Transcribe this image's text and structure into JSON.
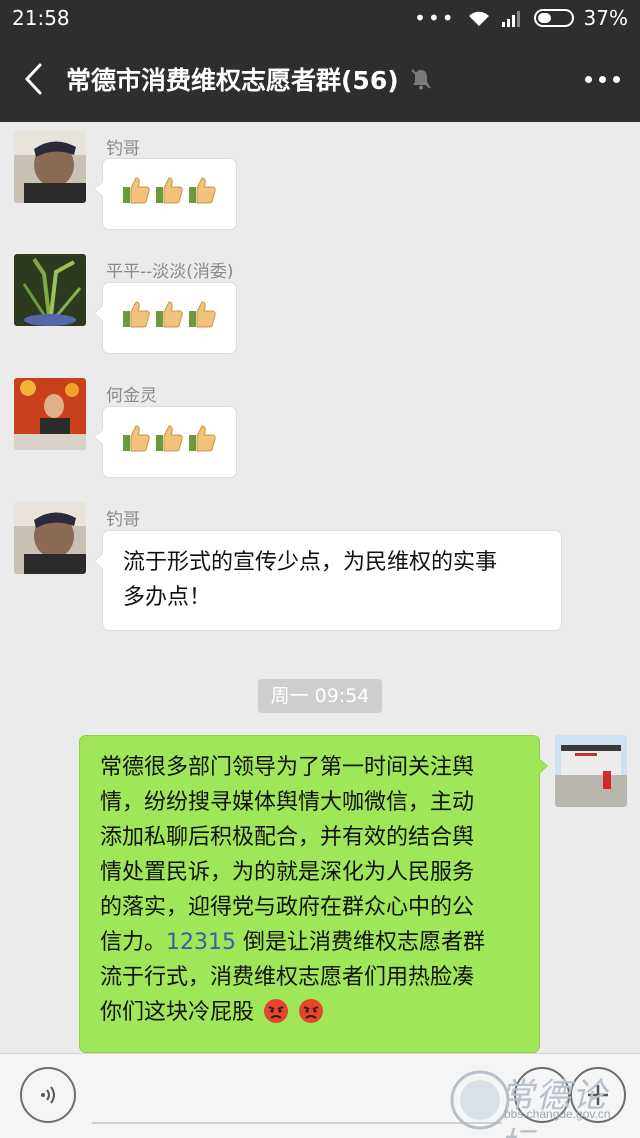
{
  "status_bar": {
    "time": "21:58",
    "dots": "•••",
    "battery_percent": "37%",
    "battery_level": 0.37
  },
  "header": {
    "title": "常德市消费维权志愿者群(56)",
    "muted": true
  },
  "messages": [
    {
      "sender": "钓哥",
      "content": "thumbs",
      "thumb_count": 3
    },
    {
      "sender": "平平--淡淡(消委)",
      "content": "thumbs",
      "thumb_count": 3
    },
    {
      "sender": "何金灵",
      "content": "thumbs",
      "thumb_count": 3
    },
    {
      "sender": "钓哥",
      "lines": [
        "流于形式的宣传少点，为民维权的实事",
        "多办点！"
      ]
    }
  ],
  "timestamp": "周一 09:54",
  "outgoing": {
    "lines": [
      "常德很多部门领导为了第一时间关注舆",
      "情，纷纷搜寻媒体舆情大咖微信，主动",
      "添加私聊后积极配合，并有效的结合舆",
      "情处置民诉，为的就是深化为人民服务",
      "的落实，迎得党与政府在群众心中的公",
      "信力。",
      "倒是让消费维权志愿者群",
      "流于行式，消费维权志愿者们用热脸凑",
      "你们这块冷屁股"
    ],
    "phone_number": "12315"
  },
  "watermark": {
    "text_cn": "常德论坛",
    "url": "bbs.changde.gov.cn"
  },
  "icons": [
    "back-arrow-icon",
    "mute-bell-icon",
    "more-icon",
    "voice-icon",
    "emoji-icon",
    "plus-icon",
    "thumbs-up-icon",
    "angry-face-icon"
  ],
  "colors": {
    "header_bg": "#2e2e2e",
    "chat_bg": "#ebebeb",
    "outgoing_bubble": "#9fe658",
    "link": "#3a5fa6"
  }
}
